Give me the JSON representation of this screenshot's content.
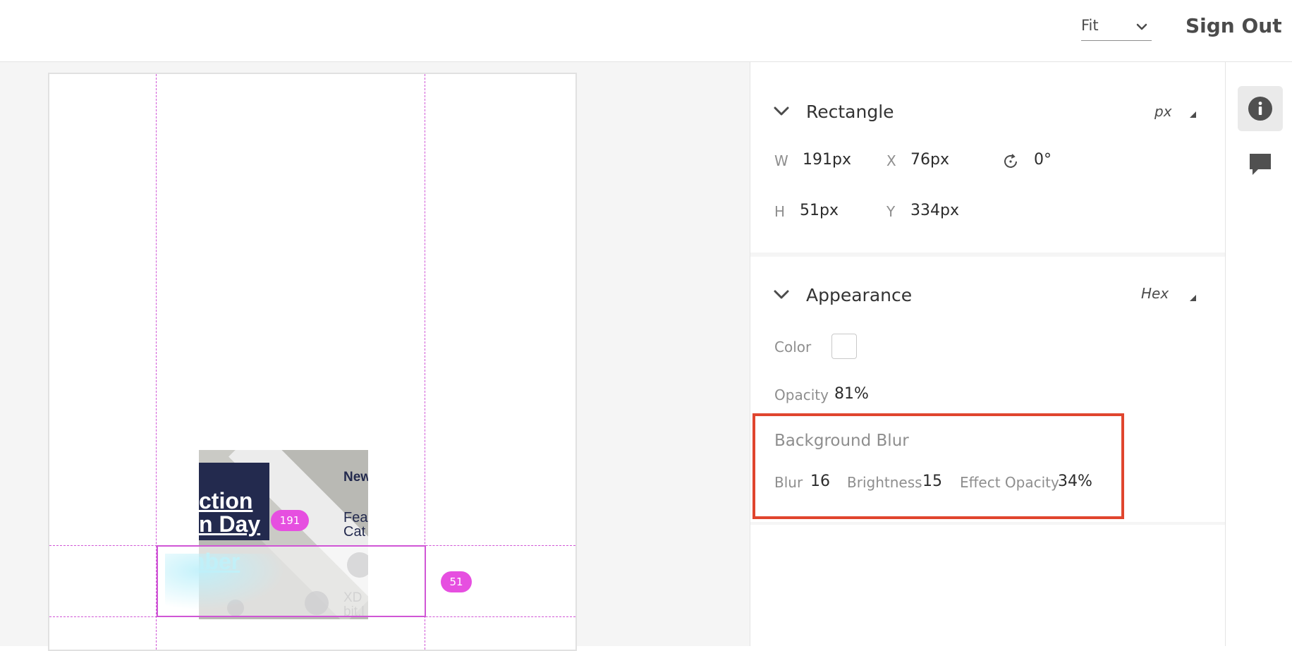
{
  "header": {
    "zoom": {
      "value": "Fit",
      "icon": "chevron-down-icon"
    },
    "sign_out_label": "Sign Out"
  },
  "canvas": {
    "thumbnail": {
      "headline_line1": "ction",
      "headline_line2": "n Day",
      "headline_line3": "mber",
      "news_text": "New",
      "feat_line1": "Fea",
      "feat_line2": "Cat",
      "xd_line1": "XD",
      "xd_line2": "bit.l"
    },
    "width_badge": "191",
    "height_badge": "51"
  },
  "panel": {
    "rectangle": {
      "title": "Rectangle",
      "unit": "px",
      "w_label": "W",
      "w_value": "191px",
      "x_label": "X",
      "x_value": "76px",
      "rotation_icon": "rotate-icon",
      "rotation_value": "0°",
      "h_label": "H",
      "h_value": "51px",
      "y_label": "Y",
      "y_value": "334px"
    },
    "appearance": {
      "title": "Appearance",
      "unit": "Hex",
      "color_label": "Color",
      "color_value": "#FFFFFF",
      "opacity_label": "Opacity",
      "opacity_value": "81%",
      "background_blur": {
        "title": "Background Blur",
        "blur_label": "Blur",
        "blur_value": "16",
        "brightness_label": "Brightness",
        "brightness_value": "15",
        "effect_opacity_label": "Effect Opacity",
        "effect_opacity_value": "34%"
      }
    }
  },
  "rail": {
    "items": [
      {
        "icon": "info-icon",
        "active": true
      },
      {
        "icon": "comment-icon",
        "active": false
      }
    ]
  },
  "colors": {
    "guide": "#d056d6",
    "badge": "#e64fe0",
    "highlight": "#e0452e",
    "navy": "#232a4e"
  }
}
